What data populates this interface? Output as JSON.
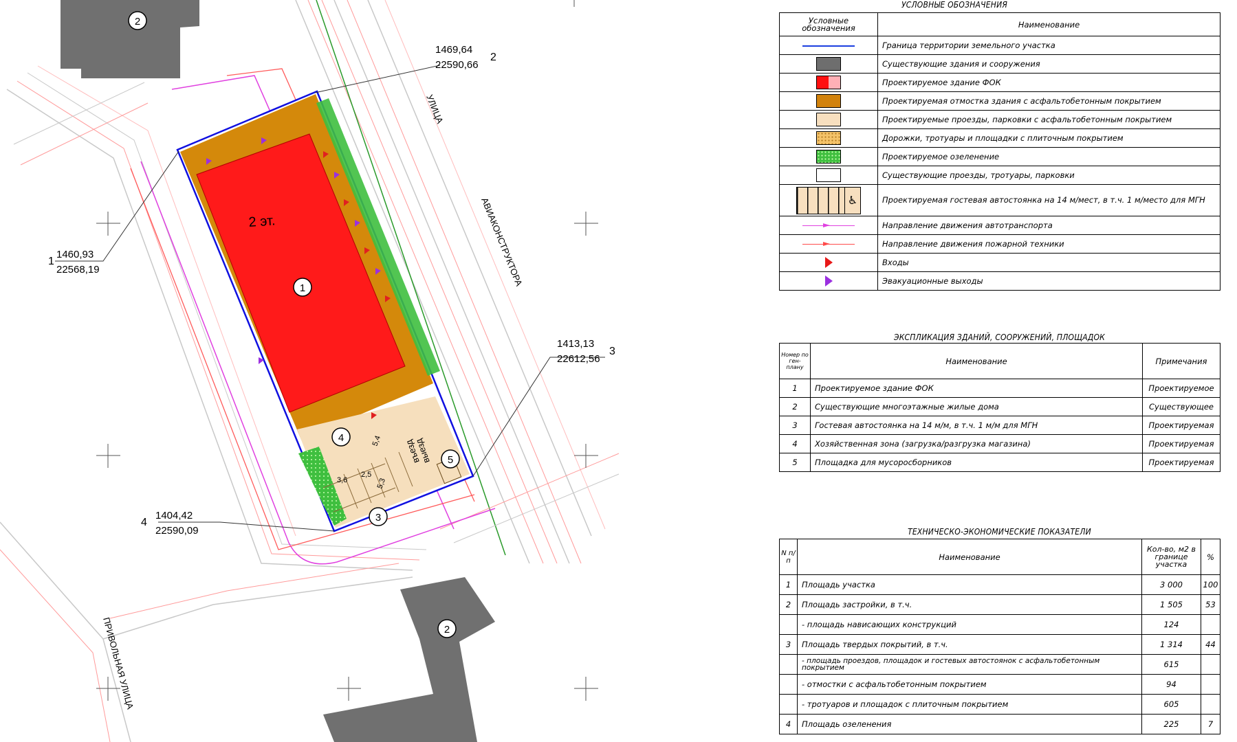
{
  "plan": {
    "corners": [
      {
        "no": "1",
        "x": "1460,93",
        "y": "22568,19"
      },
      {
        "no": "2",
        "x": "1469,64",
        "y": "22590,66"
      },
      {
        "no": "3",
        "x": "1413,13",
        "y": "22612,56"
      },
      {
        "no": "4",
        "x": "1404,42",
        "y": "22590,09"
      }
    ],
    "floors_label": "2 эт.",
    "markers": [
      "1",
      "2",
      "2",
      "3",
      "4",
      "5"
    ],
    "street_labels": [
      "АВИАКОНСТРУКТОРА",
      "УЛИЦА",
      "ПРИВОЛЬНАЯ УЛИЦА"
    ],
    "exit_labels": [
      "въезд",
      "выезд"
    ],
    "parking_dims": [
      "3,6",
      "2,5",
      "5,3",
      "5,4"
    ]
  },
  "legend": {
    "title": "УСЛОВНЫЕ ОБОЗНАЧЕНИЯ",
    "col_symbol": "Условные обозначения",
    "col_name": "Наименование",
    "rows": [
      {
        "symbol": "blue-line-icon",
        "name": "Граница территории земельного участка"
      },
      {
        "symbol": "gray-fill-icon",
        "name": "Существующие здания и сооружения"
      },
      {
        "symbol": "red-fill-icon",
        "name": "Проектируемое здание ФОК"
      },
      {
        "symbol": "orange-fill-icon",
        "name": "Проектируемая отмостка здания с асфальтобетонным покрытием"
      },
      {
        "symbol": "beige-fill-icon",
        "name": "Проектируемые проезды, парковки с асфальтобетонным покрытием"
      },
      {
        "symbol": "tile-fill-icon",
        "name": "Дорожки, тротуары и площадки с плиточным покрытием"
      },
      {
        "symbol": "green-fill-icon",
        "name": "Проектируемое озеленение"
      },
      {
        "symbol": "white-fill-icon",
        "name": "Существующие проезды, тротуары, парковки"
      },
      {
        "symbol": "parking-icon",
        "name": "Проектируемая гостевая автостоянка на 14 м/мест, в т.ч. 1 м/место для МГН"
      },
      {
        "symbol": "magenta-arrow-icon",
        "name": "Направление движения автотранспорта"
      },
      {
        "symbol": "red-arrow-icon",
        "name": "Направление движения пожарной техники"
      },
      {
        "symbol": "entrance-icon",
        "name": "Входы"
      },
      {
        "symbol": "evacuation-exit-icon",
        "name": "Эвакуационные выходы"
      }
    ]
  },
  "explication": {
    "title": "ЭКСПЛИКАЦИЯ ЗДАНИЙ, СООРУЖЕНИЙ, ПЛОЩАДОК",
    "col_no": "Номер по ген-плану",
    "col_name": "Наименование",
    "col_note": "Примечания",
    "rows": [
      {
        "no": "1",
        "name": "Проектируемое здание ФОК",
        "note": "Проектируемое"
      },
      {
        "no": "2",
        "name": "Существующие многоэтажные жилые дома",
        "note": "Существующее"
      },
      {
        "no": "3",
        "name": "Гостевая автостоянка на 14 м/м, в т.ч. 1 м/м для МГН",
        "note": "Проектируемая"
      },
      {
        "no": "4",
        "name": "Хозяйственная зона (загрузка/разгрузка магазина)",
        "note": "Проектируемая"
      },
      {
        "no": "5",
        "name": "Площадка для мусоросборников",
        "note": "Проектируемая"
      }
    ]
  },
  "tep": {
    "title": "ТЕХНИЧЕСКО-ЭКОНОМИЧЕСКИЕ ПОКАЗАТЕЛИ",
    "col_no": "N п/п",
    "col_name": "Наименование",
    "col_qty": "Кол-во, м2 в границе участка",
    "col_pct": "%",
    "rows": [
      {
        "no": "1",
        "name": "Площадь участка",
        "qty": "3 000",
        "pct": "100"
      },
      {
        "no": "2",
        "name": "Площадь застройки, в т.ч.",
        "qty": "1 505",
        "pct": "53"
      },
      {
        "no": "",
        "name": "- площадь нависающих конструкций",
        "qty": "124",
        "pct": ""
      },
      {
        "no": "3",
        "name": "Площадь твердых покрытий, в т.ч.",
        "qty": "1 314",
        "pct": "44"
      },
      {
        "no": "",
        "name": "- площадь проездов, площадок и гостевых автостоянок с асфальтобетонным покрытием",
        "qty": "615",
        "pct": ""
      },
      {
        "no": "",
        "name": "- отмостки с асфальтобетонным покрытием",
        "qty": "94",
        "pct": ""
      },
      {
        "no": "",
        "name": "- тротуаров и площадок с плиточным покрытием",
        "qty": "605",
        "pct": ""
      },
      {
        "no": "4",
        "name": "Площадь озеленения",
        "qty": "225",
        "pct": "7"
      }
    ]
  }
}
